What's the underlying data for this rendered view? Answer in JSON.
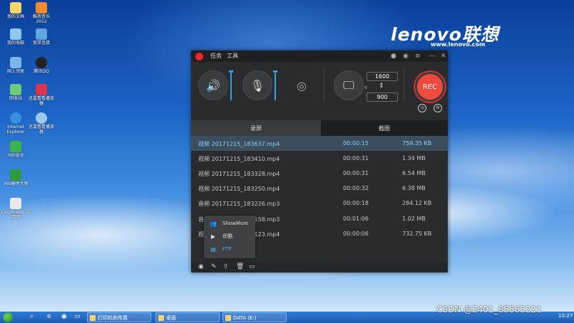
{
  "desktop": {
    "brand": "lenovo联想",
    "brand_url": "www.lenovo.com",
    "icons": [
      {
        "label": "我的文档"
      },
      {
        "label": "酷我音乐\n2012"
      },
      {
        "label": "我的电脑"
      },
      {
        "label": "宽带连接"
      },
      {
        "label": "网上邻居"
      },
      {
        "label": "腾讯QQ"
      },
      {
        "label": "回收站"
      },
      {
        "label": "迅雷看看播放\n器"
      },
      {
        "label": "Internet\nExplorer"
      },
      {
        "label": "迅雷看看播放\n器"
      },
      {
        "label": "360安全"
      },
      {
        "label": "360硬件大师"
      },
      {
        "label": "CamStudio 试\n用版"
      }
    ]
  },
  "recorder": {
    "menu": [
      "任务",
      "工具"
    ],
    "width": "1600",
    "height": "900",
    "rec_label": "REC",
    "tabs": [
      "录屏",
      "截图"
    ],
    "files": [
      {
        "name": "视频 20171215_183637.mp4",
        "duration": "00:00:15",
        "size": "759.35 KB"
      },
      {
        "name": "视频 20171215_183410.mp4",
        "duration": "00:00:31",
        "size": "1.34 MB"
      },
      {
        "name": "视频 20171215_183328.mp4",
        "duration": "00:00:31",
        "size": "6.54 MB"
      },
      {
        "name": "视频 20171215_183250.mp4",
        "duration": "00:00:32",
        "size": "6.38 MB"
      },
      {
        "name": "音频 20171215_183226.mp3",
        "duration": "00:00:18",
        "size": "284.12 KB"
      },
      {
        "name": "音频 20171215_183158.mp3",
        "duration": "00:01:06",
        "size": "1.02 MB"
      },
      {
        "name": "视频 20171215_183123.mp4",
        "duration": "00:00:06",
        "size": "732.75 KB"
      }
    ],
    "popup": [
      "ShowMore",
      "优酷",
      "FTP"
    ],
    "speaker_level": 0.95,
    "mic_level": 0.95
  },
  "taskbar": {
    "tasks": [
      "打印机和传真",
      "桌面",
      "DATA (E:)"
    ],
    "clock": "10:27"
  },
  "watermark": "CSDN @2401_85565221"
}
